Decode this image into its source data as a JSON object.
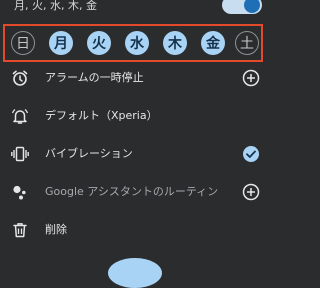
{
  "header": {
    "repeat_summary": "月, 火, 水, 木, 金"
  },
  "alarm_toggle": {
    "state": "on"
  },
  "days": [
    {
      "label": "日",
      "selected": false
    },
    {
      "label": "月",
      "selected": true
    },
    {
      "label": "火",
      "selected": true
    },
    {
      "label": "水",
      "selected": true
    },
    {
      "label": "木",
      "selected": true
    },
    {
      "label": "金",
      "selected": true
    },
    {
      "label": "土",
      "selected": false
    }
  ],
  "options": [
    {
      "icon": "alarm-clock-icon",
      "label": "アラームの一時停止",
      "action": "add-icon"
    },
    {
      "icon": "bell-icon",
      "label": "デフォルト（Xperia）",
      "action": ""
    },
    {
      "icon": "vibration-icon",
      "label": "バイブレーション",
      "action": "checkmark-icon"
    },
    {
      "icon": "google-assistant-icon",
      "label": "Google アシスタントのルーティン",
      "action": "add-icon"
    },
    {
      "icon": "trash-icon",
      "label": "削除",
      "action": ""
    }
  ],
  "colors": {
    "background": "#2b2c2e",
    "accent_light": "#a9d3f5",
    "highlight_frame": "#e24a2b"
  }
}
